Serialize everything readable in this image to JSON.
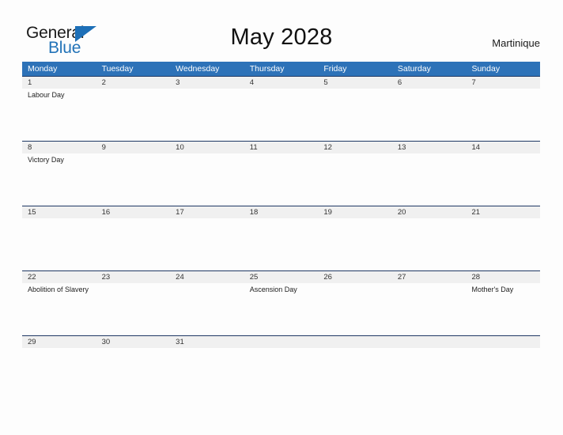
{
  "header": {
    "logo": {
      "word_one": "General",
      "word_two": "Blue",
      "flag_icon": "blue-triangle-flag-icon"
    },
    "title": "May 2028",
    "location": "Martinique"
  },
  "calendar": {
    "day_headers": [
      "Monday",
      "Tuesday",
      "Wednesday",
      "Thursday",
      "Friday",
      "Saturday",
      "Sunday"
    ],
    "colors": {
      "header_blue": "#2d72b8",
      "rule_navy": "#1f3864",
      "date_band_gray": "#f0f0f0",
      "logo_blue": "#2273b8",
      "page_background": "#fdfdfd"
    },
    "weeks": [
      {
        "days": [
          {
            "date": "1",
            "event": "Labour Day"
          },
          {
            "date": "2",
            "event": ""
          },
          {
            "date": "3",
            "event": ""
          },
          {
            "date": "4",
            "event": ""
          },
          {
            "date": "5",
            "event": ""
          },
          {
            "date": "6",
            "event": ""
          },
          {
            "date": "7",
            "event": ""
          }
        ]
      },
      {
        "days": [
          {
            "date": "8",
            "event": "Victory Day"
          },
          {
            "date": "9",
            "event": ""
          },
          {
            "date": "10",
            "event": ""
          },
          {
            "date": "11",
            "event": ""
          },
          {
            "date": "12",
            "event": ""
          },
          {
            "date": "13",
            "event": ""
          },
          {
            "date": "14",
            "event": ""
          }
        ]
      },
      {
        "days": [
          {
            "date": "15",
            "event": ""
          },
          {
            "date": "16",
            "event": ""
          },
          {
            "date": "17",
            "event": ""
          },
          {
            "date": "18",
            "event": ""
          },
          {
            "date": "19",
            "event": ""
          },
          {
            "date": "20",
            "event": ""
          },
          {
            "date": "21",
            "event": ""
          }
        ]
      },
      {
        "days": [
          {
            "date": "22",
            "event": "Abolition of Slavery"
          },
          {
            "date": "23",
            "event": ""
          },
          {
            "date": "24",
            "event": ""
          },
          {
            "date": "25",
            "event": "Ascension Day"
          },
          {
            "date": "26",
            "event": ""
          },
          {
            "date": "27",
            "event": ""
          },
          {
            "date": "28",
            "event": "Mother's Day"
          }
        ]
      },
      {
        "days": [
          {
            "date": "29",
            "event": ""
          },
          {
            "date": "30",
            "event": ""
          },
          {
            "date": "31",
            "event": ""
          },
          {
            "date": "",
            "event": ""
          },
          {
            "date": "",
            "event": ""
          },
          {
            "date": "",
            "event": ""
          },
          {
            "date": "",
            "event": ""
          }
        ]
      }
    ]
  }
}
